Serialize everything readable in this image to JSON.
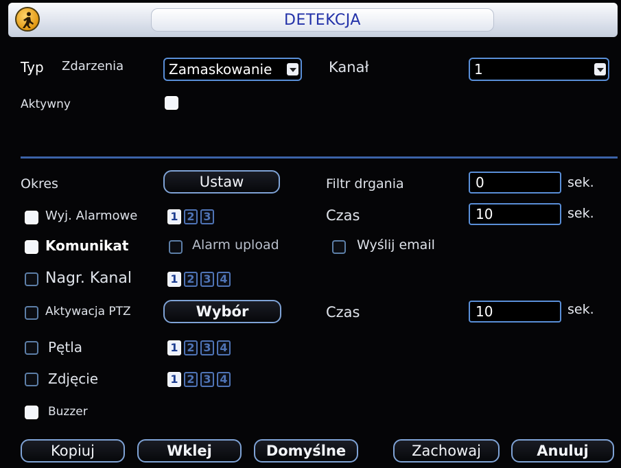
{
  "window": {
    "title": "DETEKCJA",
    "icon": "pedestrian-icon"
  },
  "event": {
    "type_label_1": "Typ",
    "type_label_2": "Zdarzenia",
    "type_value": "Zamaskowanie",
    "channel_label": "Kanał",
    "channel_value": "1",
    "active_label": "Aktywny",
    "active_checked": true
  },
  "settings": {
    "period_label": "Okres",
    "period_button": "Ustaw",
    "debounce_label": "Filtr drgania",
    "debounce_value": "0",
    "debounce_unit": "sek.",
    "alarm_out_label": "Wyj. Alarmowe",
    "alarm_out_checked": true,
    "alarm_out_channels": [
      {
        "n": "1",
        "on": true
      },
      {
        "n": "2",
        "on": false
      },
      {
        "n": "3",
        "on": false
      }
    ],
    "time1_label": "Czas",
    "time1_value": "10",
    "time1_unit": "sek.",
    "message_label": "Komunikat",
    "message_checked": true,
    "alarm_upload_label": "Alarm upload",
    "alarm_upload_checked": false,
    "email_label": "Wyślij email",
    "email_checked": false,
    "record_label": "Nagr. Kanal",
    "record_checked": false,
    "record_channels": [
      {
        "n": "1",
        "on": true
      },
      {
        "n": "2",
        "on": false
      },
      {
        "n": "3",
        "on": false
      },
      {
        "n": "4",
        "on": false
      }
    ],
    "ptz_label": "Aktywacja PTZ",
    "ptz_checked": false,
    "ptz_button": "Wybór",
    "time2_label": "Czas",
    "time2_value": "10",
    "time2_unit": "sek.",
    "tour_label": "Pętla",
    "tour_checked": false,
    "tour_channels": [
      {
        "n": "1",
        "on": true
      },
      {
        "n": "2",
        "on": false
      },
      {
        "n": "3",
        "on": false
      },
      {
        "n": "4",
        "on": false
      }
    ],
    "snapshot_label": "Zdjęcie",
    "snapshot_checked": false,
    "snapshot_channels": [
      {
        "n": "1",
        "on": true
      },
      {
        "n": "2",
        "on": false
      },
      {
        "n": "3",
        "on": false
      },
      {
        "n": "4",
        "on": false
      }
    ],
    "buzzer_label": "Buzzer",
    "buzzer_checked": true
  },
  "footer": {
    "copy": "Kopiuj",
    "paste": "Wklej",
    "default": "Domyślne",
    "save": "Zachowaj",
    "cancel": "Anuluj"
  }
}
